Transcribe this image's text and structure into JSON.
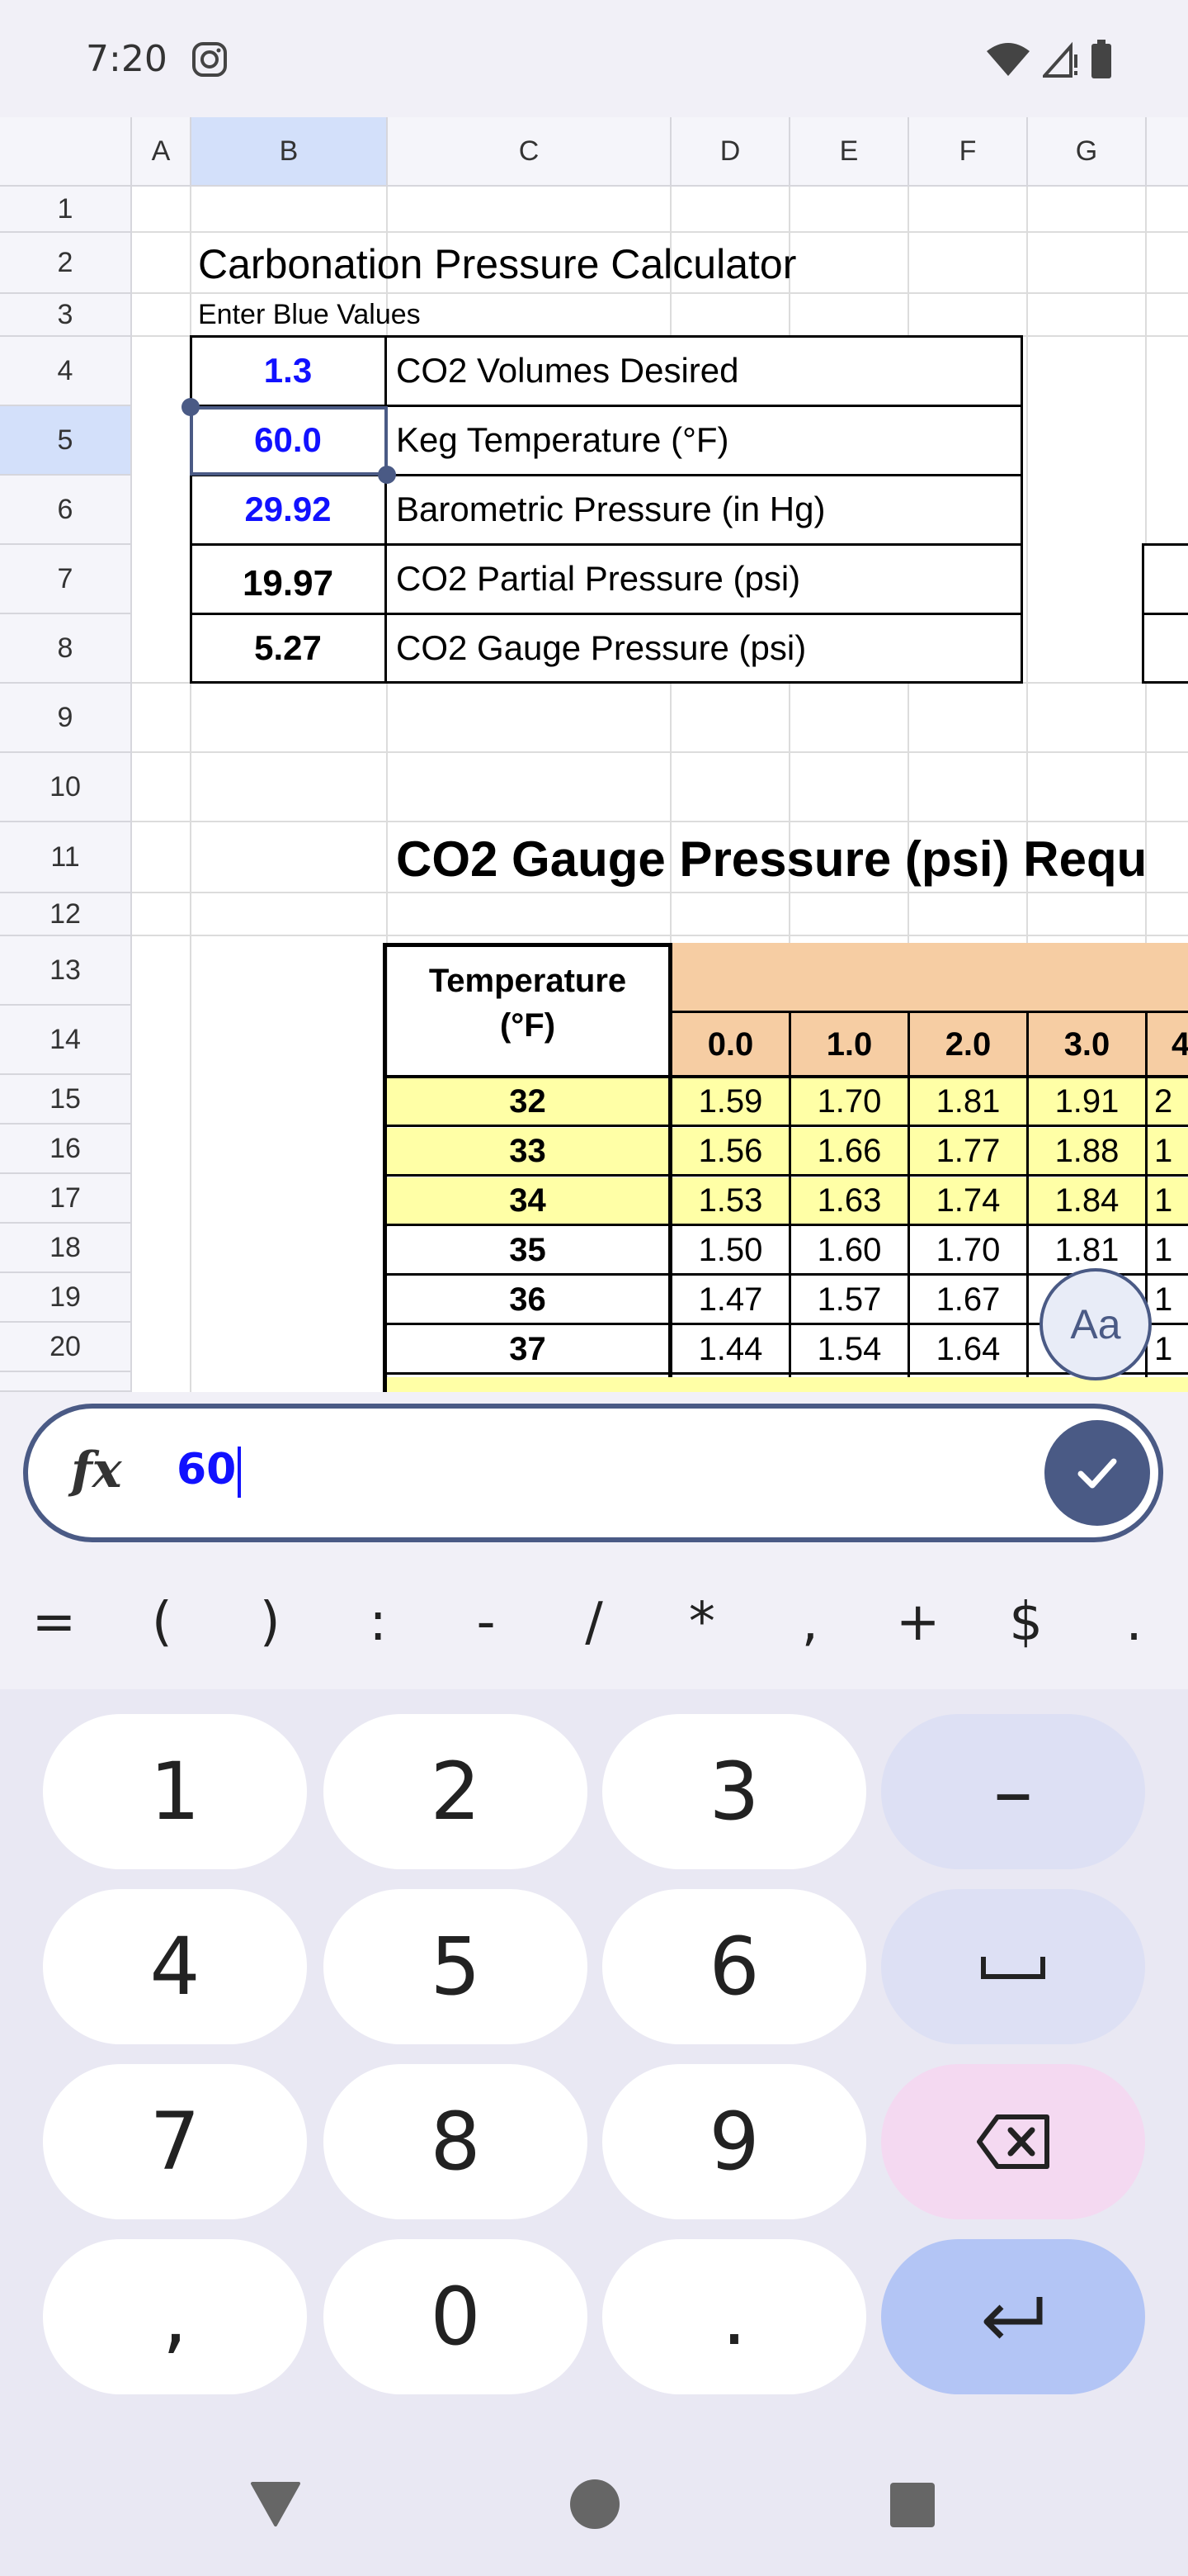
{
  "status": {
    "time": "7:20"
  },
  "sheet": {
    "columns": [
      "A",
      "B",
      "C",
      "D",
      "E",
      "F",
      "G"
    ],
    "rows": [
      "1",
      "2",
      "3",
      "4",
      "5",
      "6",
      "7",
      "8",
      "9",
      "10",
      "11",
      "12",
      "13",
      "14",
      "15",
      "16",
      "17",
      "18",
      "19",
      "20"
    ],
    "title": "Carbonation Pressure Calculator",
    "subtitle": "Enter Blue Values",
    "inputs": [
      {
        "value": "1.3",
        "label": "CO2 Volumes Desired"
      },
      {
        "value": "60.0",
        "label": "Keg Temperature (°F)"
      },
      {
        "value": "29.92",
        "label": "Barometric Pressure (in Hg)"
      },
      {
        "value": "19.97",
        "label": "CO2 Partial Pressure (psi)"
      },
      {
        "value": "5.27",
        "label": "CO2 Gauge Pressure (psi)"
      }
    ],
    "table_title": "CO2 Gauge Pressure (psi) Requ",
    "table_header": {
      "temperature": "Temperature",
      "unit": "(°F)",
      "cols": [
        "0.0",
        "1.0",
        "2.0",
        "3.0",
        "4"
      ]
    },
    "table_rows": [
      {
        "temp": "32",
        "vals": [
          "1.59",
          "1.70",
          "1.81",
          "1.91",
          "2"
        ],
        "highlight": true
      },
      {
        "temp": "33",
        "vals": [
          "1.56",
          "1.66",
          "1.77",
          "1.88",
          "1"
        ],
        "highlight": true
      },
      {
        "temp": "34",
        "vals": [
          "1.53",
          "1.63",
          "1.74",
          "1.84",
          "1"
        ],
        "highlight": true
      },
      {
        "temp": "35",
        "vals": [
          "1.50",
          "1.60",
          "1.70",
          "1.81",
          "1"
        ],
        "highlight": false
      },
      {
        "temp": "36",
        "vals": [
          "1.47",
          "1.57",
          "1.67",
          "",
          "1"
        ],
        "highlight": false
      },
      {
        "temp": "37",
        "vals": [
          "1.44",
          "1.54",
          "1.64",
          "",
          "1"
        ],
        "highlight": false
      }
    ]
  },
  "format_button": "Aa",
  "formula": {
    "icon": "fx",
    "value": "60"
  },
  "symbols": [
    "=",
    "(",
    ")",
    ":",
    "-",
    "/",
    "*",
    ",",
    "+",
    "$",
    "."
  ],
  "keys": {
    "digits": [
      "1",
      "2",
      "3",
      "4",
      "5",
      "6",
      "7",
      "8",
      "9",
      ",",
      "0",
      "."
    ],
    "minus": "–"
  },
  "colors": {
    "accent": "#4a5a85",
    "input_blue": "#1111ff",
    "header_orange": "#f6cda3",
    "row_yellow": "#ffffa6",
    "selected_header": "#d3e0fa"
  }
}
